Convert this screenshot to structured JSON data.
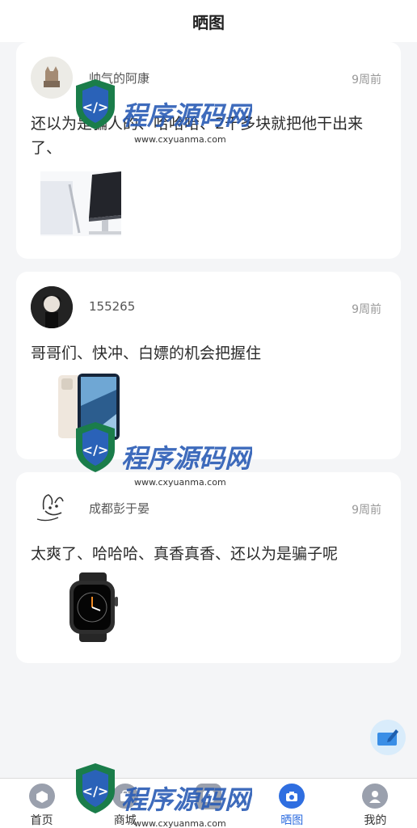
{
  "header": {
    "title": "晒图"
  },
  "posts": [
    {
      "username": "帅气的阿康",
      "time": "9周前",
      "text": "还以为是骗人的、哈哈哈、2千多块就把他干出来了、",
      "image": "monitor"
    },
    {
      "username": "155265",
      "time": "9周前",
      "text": "哥哥们、快冲、白嫖的机会把握住",
      "image": "phone"
    },
    {
      "username": "成都彭于晏",
      "time": "9周前",
      "text": "太爽了、哈哈哈、真香真香、还以为是骗子呢",
      "image": "watch"
    }
  ],
  "fab": {
    "icon": "edit-icon"
  },
  "tabbar": {
    "items": [
      {
        "label": "首页",
        "icon": "home-icon",
        "active": false
      },
      {
        "label": "商城",
        "icon": "shop-icon",
        "active": false
      },
      {
        "label": "",
        "icon": "message-icon",
        "active": false
      },
      {
        "label": "晒图",
        "icon": "camera-icon",
        "active": true
      },
      {
        "label": "我的",
        "icon": "user-icon",
        "active": false
      }
    ]
  },
  "watermark": {
    "text": "程序源码网",
    "url": "www.cxyuanma.com"
  },
  "colors": {
    "accent": "#2f6ee0",
    "background": "#f4f5f7",
    "card": "#ffffff"
  }
}
